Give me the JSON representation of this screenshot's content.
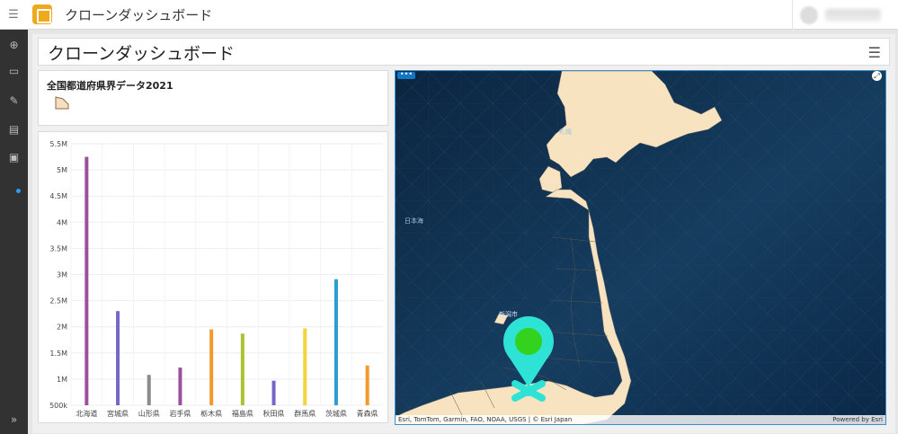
{
  "header": {
    "title": "クローンダッシュボード"
  },
  "dashboard": {
    "title": "クローンダッシュボード"
  },
  "legend": {
    "title": "全国都道府県界データ2021",
    "swatch_color": "#f5dfc0"
  },
  "map": {
    "attribution": "Esri, TomTom, Garmin, FAO, NOAA, USGS | © Esri Japan",
    "powered_by": "Powered by Esri",
    "labels": [
      {
        "key": "sea",
        "text": "日本海"
      },
      {
        "key": "city",
        "text": "新潟市"
      },
      {
        "key": "hokkaido",
        "text": "札幌"
      }
    ],
    "colors": {
      "land": "#f8e3c1",
      "water": "#0f2c49",
      "pin": "#2ee3d6",
      "pin_center": "#33d21e"
    }
  },
  "chart_data": {
    "type": "bar",
    "categories": [
      "北海道",
      "宮城県",
      "山形県",
      "岩手県",
      "栃木県",
      "福島県",
      "秋田県",
      "群馬県",
      "茨城県",
      "青森県"
    ],
    "values": [
      5250000,
      2300000,
      1080000,
      1220000,
      1950000,
      1870000,
      970000,
      1970000,
      2910000,
      1260000
    ],
    "colors": [
      "#9c4f9a",
      "#7367c7",
      "#8b8b8b",
      "#9c4f9a",
      "#f19a2c",
      "#a9c232",
      "#7367c7",
      "#f4d33c",
      "#2a9ed0",
      "#f19a2c"
    ],
    "yticks": [
      "500k",
      "1M",
      "1.5M",
      "2M",
      "2.5M",
      "3M",
      "3.5M",
      "4M",
      "4.5M",
      "5M",
      "5.5M"
    ],
    "ylim": [
      500000,
      5500000
    ]
  }
}
